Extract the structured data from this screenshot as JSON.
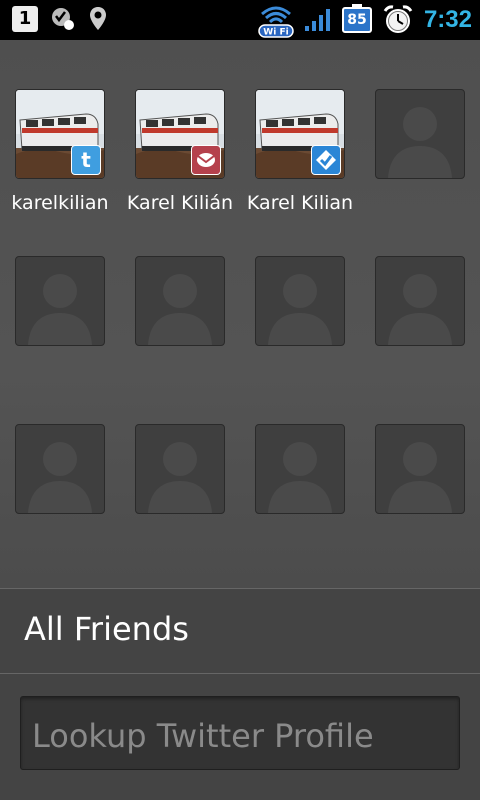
{
  "status_bar": {
    "notification_count": "1",
    "icons": [
      "notification-icon",
      "voicemail-icon",
      "location-icon",
      "wifi-icon",
      "signal-icon",
      "battery-icon",
      "alarm-icon"
    ],
    "wifi_label": "Wi Fi",
    "battery_level": "85",
    "time": "7:32",
    "time_color": "#33b5e5"
  },
  "friends": [
    {
      "name": "karelkilian",
      "photo": true,
      "badge": "twitter-badge-icon"
    },
    {
      "name": "Karel Kilián",
      "photo": true,
      "badge": "mail-badge-icon"
    },
    {
      "name": "Karel Kilian",
      "photo": true,
      "badge": "other-badge-icon"
    },
    {
      "name": "",
      "photo": false
    },
    {
      "name": "",
      "photo": false
    },
    {
      "name": "",
      "photo": false
    },
    {
      "name": "",
      "photo": false
    },
    {
      "name": "",
      "photo": false
    },
    {
      "name": "",
      "photo": false
    },
    {
      "name": "",
      "photo": false
    },
    {
      "name": "",
      "photo": false
    },
    {
      "name": "",
      "photo": false
    }
  ],
  "bottom": {
    "title": "All Friends",
    "search_placeholder": "Lookup Twitter Profile"
  }
}
